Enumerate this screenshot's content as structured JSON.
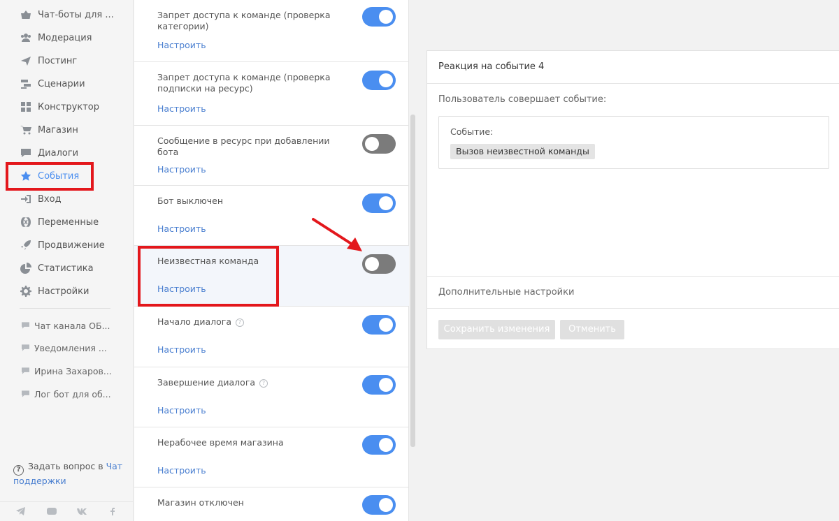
{
  "sidebar": {
    "nav": [
      {
        "label": "Чат-боты для ...",
        "icon": "basket-icon"
      },
      {
        "label": "Модерация",
        "icon": "users-icon"
      },
      {
        "label": "Постинг",
        "icon": "paper-plane-icon"
      },
      {
        "label": "Сценарии",
        "icon": "scenario-icon"
      },
      {
        "label": "Конструктор",
        "icon": "grid-icon"
      },
      {
        "label": "Магазин",
        "icon": "cart-icon"
      },
      {
        "label": "Диалоги",
        "icon": "chat-bubble-icon"
      },
      {
        "label": "События",
        "icon": "star-icon"
      },
      {
        "label": "Вход",
        "icon": "sign-in-icon"
      },
      {
        "label": "Переменные",
        "icon": "variable-icon"
      },
      {
        "label": "Продвижение",
        "icon": "rocket-icon"
      },
      {
        "label": "Статистика",
        "icon": "pie-chart-icon"
      },
      {
        "label": "Настройки",
        "icon": "gear-icon"
      }
    ],
    "chats": [
      {
        "label": "Чат канала ОБ..."
      },
      {
        "label": "Уведомления ..."
      },
      {
        "label": "Ирина Захаров..."
      },
      {
        "label": "Лог бот для об..."
      }
    ],
    "help": {
      "text": "Задать вопрос в",
      "link_line1": "Чат",
      "link_line2": "поддержки"
    }
  },
  "events": {
    "configure_label": "Настроить",
    "items": [
      {
        "title": "Запрет доступа к команде (проверка категории)",
        "enabled": true
      },
      {
        "title": "Запрет доступа к команде (проверка подписки на ресурс)",
        "enabled": true
      },
      {
        "title": "Сообщение в ресурс при добавлении бота",
        "enabled": false
      },
      {
        "title": "Бот выключен",
        "enabled": true
      },
      {
        "title": "Неизвестная команда",
        "enabled": false
      },
      {
        "title": "Начало диалога",
        "enabled": true
      },
      {
        "title": "Завершение диалога",
        "enabled": true
      },
      {
        "title": "Нерабочее время магазина",
        "enabled": true
      },
      {
        "title": "Магазин отключен",
        "enabled": true
      }
    ]
  },
  "panel": {
    "title": "Реакция на событие 4",
    "subtitle": "Пользователь совершает событие:",
    "event_label": "Событие:",
    "event_value": "Вызов неизвестной команды",
    "advanced": "Дополнительные настройки",
    "save": "Сохранить изменения",
    "cancel": "Отменить"
  },
  "colors": {
    "accent": "#4a8ef0",
    "toggle_off": "#7b7b7b",
    "annotation_red": "#e3171c"
  }
}
